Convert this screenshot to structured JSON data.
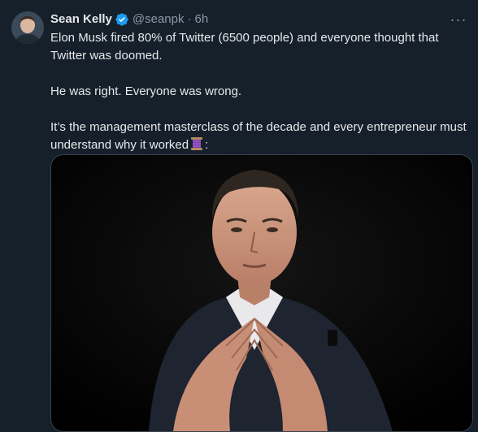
{
  "author": {
    "name": "Sean Kelly",
    "handle": "@seanpk",
    "separator": "·",
    "time": "6h",
    "verified_icon": "verified-badge-icon",
    "verified_color": "#1d9bf0"
  },
  "more_label": "···",
  "tweet": {
    "paragraphs": [
      "Elon Musk fired 80% of Twitter (6500 people) and everyone thought that Twitter was doomed.",
      "He was right. Everyone was wrong.",
      "It’s the management masterclass of the decade and every entrepreneur must understand why it worked"
    ],
    "trailing": ":",
    "emoji_icon": "thread-spool-icon"
  },
  "media": {
    "type": "photo",
    "subject": "man-with-steepled-hands"
  },
  "colors": {
    "background": "#15202b",
    "text": "#e7e9ea",
    "muted": "#8b98a5",
    "border": "#38444d",
    "accent": "#1d9bf0"
  }
}
